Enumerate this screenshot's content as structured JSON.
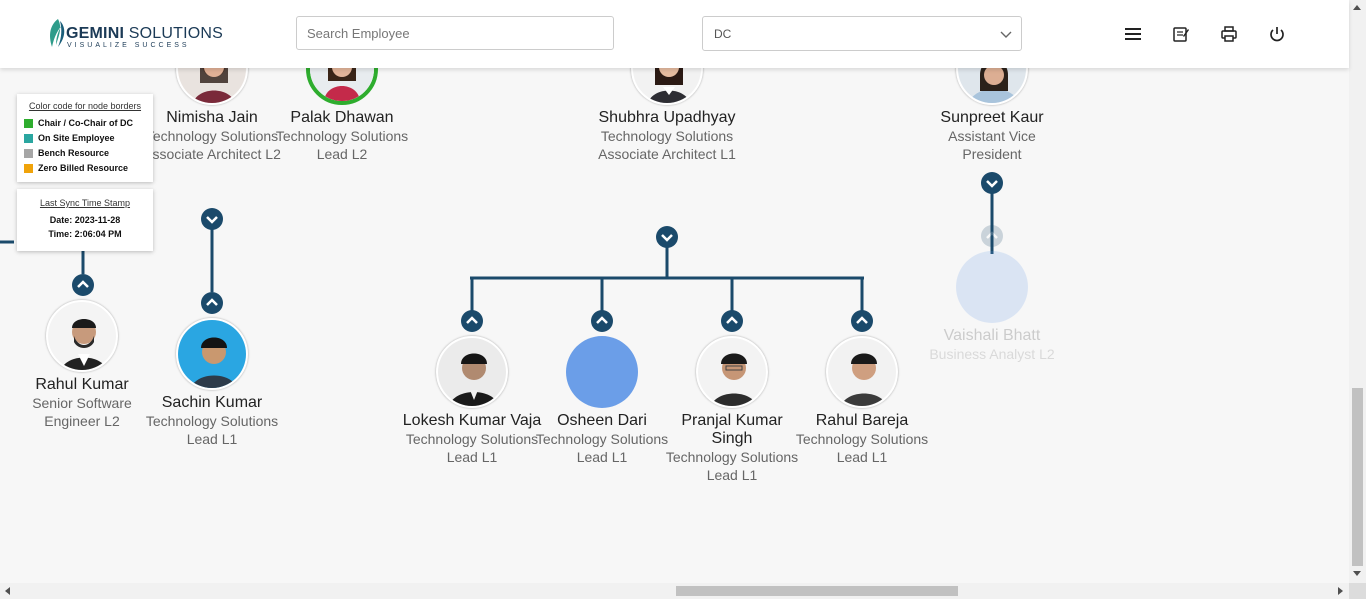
{
  "header": {
    "logo_name_bold": "GEMINI",
    "logo_name_rest": " SOLUTIONS",
    "logo_tagline": "VISUALIZE SUCCESS",
    "search_placeholder": "Search Employee",
    "dept_select_value": "DC",
    "icons": [
      "menu-icon",
      "notes-icon",
      "print-icon",
      "power-icon"
    ]
  },
  "legend": {
    "title": "Color code for node borders",
    "items": [
      {
        "label": "Chair / Co-Chair of DC",
        "color": "#2ead2e"
      },
      {
        "label": "On Site Employee",
        "color": "#2aa6a0"
      },
      {
        "label": "Bench Resource",
        "color": "#a6a6a6"
      },
      {
        "label": "Zero Billed Resource",
        "color": "#f0a30a"
      }
    ]
  },
  "sync": {
    "title": "Last Sync Time Stamp",
    "date": "Date: 2023-11-28",
    "time": "Time: 2:06:04 PM"
  },
  "nodes": {
    "nimisha": {
      "name": "Nimisha Jain",
      "designation": "Technology Solutions Associate Architect L2"
    },
    "palak": {
      "name": "Palak Dhawan",
      "designation": "Technology Solutions Lead L2"
    },
    "shubhra": {
      "name": "Shubhra Upadhyay",
      "designation": "Technology Solutions Associate Architect L1"
    },
    "sunpreet": {
      "name": "Sunpreet Kaur",
      "designation": "Assistant Vice President"
    },
    "rahul_kumar": {
      "name": "Rahul Kumar",
      "designation": "Senior Software Engineer L2"
    },
    "sachin": {
      "name": "Sachin Kumar",
      "designation": "Technology Solutions Lead L1"
    },
    "lokesh": {
      "name": "Lokesh Kumar Vaja",
      "designation": "Technology Solutions Lead L1"
    },
    "osheen": {
      "name": "Osheen Dari",
      "designation": "Technology Solutions Lead L1"
    },
    "pranjal": {
      "name": "Pranjal Kumar Singh",
      "designation": "Technology Solutions Lead L1"
    },
    "rahul_bareja": {
      "name": "Rahul Bareja",
      "designation": "Technology Solutions Lead L1"
    },
    "vaishali": {
      "name": "Vaishali Bhatt",
      "designation": "Business Analyst L2"
    }
  },
  "colors": {
    "connector": "#1b4a6b",
    "chair_border": "#2ead2e",
    "placeholder_photo": "#6b9ee8"
  }
}
